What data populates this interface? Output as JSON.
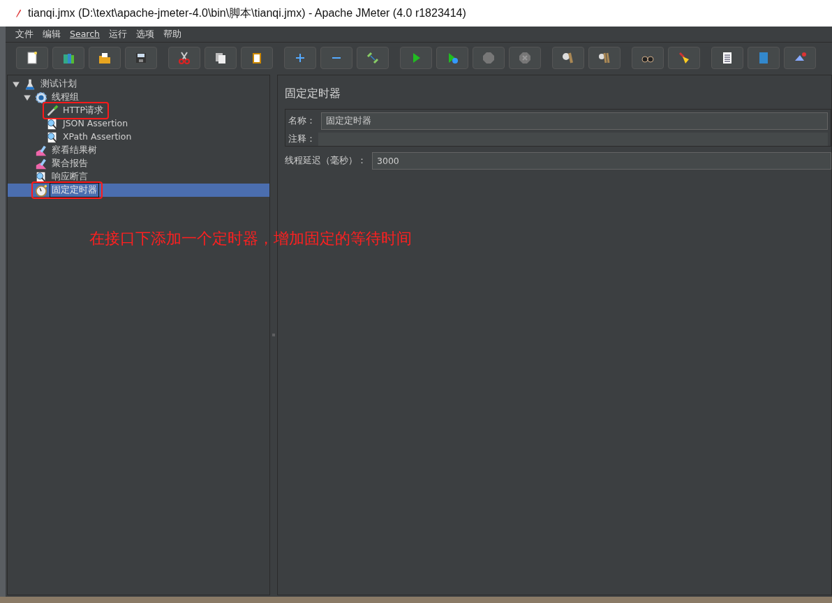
{
  "window": {
    "title": "tianqi.jmx (D:\\text\\apache-jmeter-4.0\\bin\\脚本\\tianqi.jmx) - Apache JMeter (4.0 r1823414)"
  },
  "menu": [
    "文件",
    "编辑",
    "Search",
    "运行",
    "选项",
    "帮助"
  ],
  "tree": [
    {
      "label": "测试计划",
      "kind": "plan",
      "expanded": true,
      "selected": false,
      "highlighted": false,
      "children": [
        {
          "label": "线程组",
          "kind": "thread-group",
          "expanded": true,
          "selected": false,
          "highlighted": false,
          "children": [
            {
              "label": "HTTP请求",
              "kind": "sampler",
              "selected": false,
              "highlighted": true
            },
            {
              "label": "JSON Assertion",
              "kind": "assertion",
              "selected": false,
              "highlighted": false
            },
            {
              "label": "XPath Assertion",
              "kind": "assertion",
              "selected": false,
              "highlighted": false
            }
          ]
        },
        {
          "label": "察看结果树",
          "kind": "listener",
          "selected": false,
          "highlighted": false
        },
        {
          "label": "聚合报告",
          "kind": "listener",
          "selected": false,
          "highlighted": false
        },
        {
          "label": "响应断言",
          "kind": "assertion",
          "selected": false,
          "highlighted": false
        },
        {
          "label": "固定定时器",
          "kind": "timer",
          "selected": true,
          "highlighted": true
        }
      ]
    }
  ],
  "panel": {
    "title": "固定定时器",
    "name_label": "名称：",
    "name_value": "固定定时器",
    "comment_label": "注释：",
    "delay_label": "线程延迟（毫秒）：",
    "delay_value": "3000"
  },
  "annotation": {
    "text": "在接口下添加一个定时器，增加固定的等待时间"
  }
}
